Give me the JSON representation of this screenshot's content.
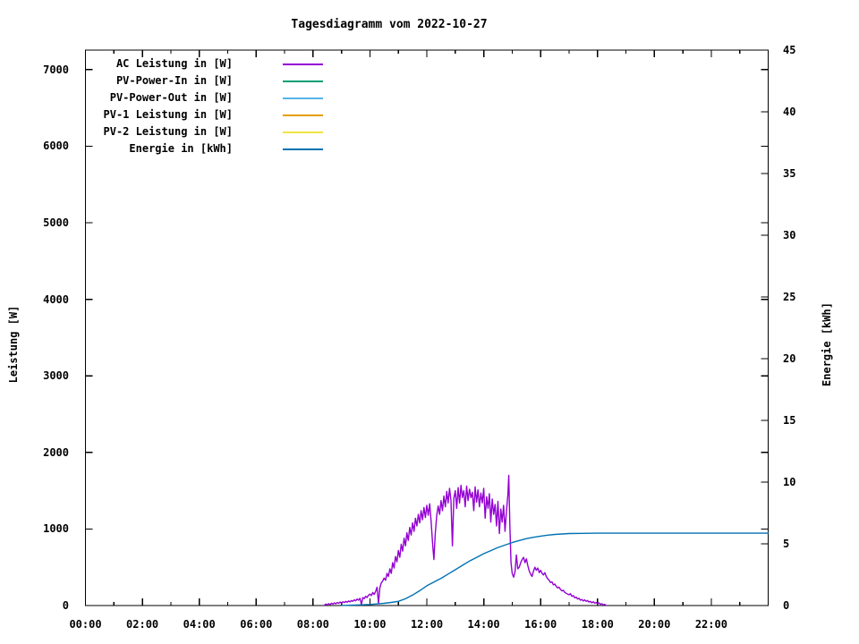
{
  "chart_data": {
    "type": "line",
    "title": "Tagesdiagramm vom 2022-10-27",
    "ylabel": "Leistung [W]",
    "y2label": "Energie [kWh]",
    "x_tick_labels": [
      "00:00",
      "02:00",
      "04:00",
      "06:00",
      "08:00",
      "10:00",
      "12:00",
      "14:00",
      "16:00",
      "18:00",
      "20:00",
      "22:00"
    ],
    "x_range_hours": [
      0,
      24
    ],
    "x_minor_tick_hours": 1,
    "x_major_tick_hours": 2,
    "y1_ticks": [
      0,
      1000,
      2000,
      3000,
      4000,
      5000,
      6000,
      7000
    ],
    "y1_range": [
      0,
      7260
    ],
    "y2_ticks": [
      0,
      5,
      10,
      15,
      20,
      25,
      30,
      35,
      40,
      45
    ],
    "y2_range": [
      0,
      45
    ],
    "grid": false,
    "legend_position": "top-left-inside",
    "series": [
      {
        "name": "AC Leistung in [W]",
        "color": "#9400d3",
        "axis": "y1",
        "visible": true,
        "points": [
          [
            8.4,
            5
          ],
          [
            8.45,
            20
          ],
          [
            8.5,
            8
          ],
          [
            8.55,
            25
          ],
          [
            8.6,
            12
          ],
          [
            8.65,
            30
          ],
          [
            8.7,
            18
          ],
          [
            8.75,
            35
          ],
          [
            8.8,
            22
          ],
          [
            8.85,
            40
          ],
          [
            8.9,
            28
          ],
          [
            8.95,
            45
          ],
          [
            9.0,
            32
          ],
          [
            9.05,
            50
          ],
          [
            9.1,
            38
          ],
          [
            9.15,
            55
          ],
          [
            9.2,
            42
          ],
          [
            9.25,
            60
          ],
          [
            9.3,
            48
          ],
          [
            9.35,
            65
          ],
          [
            9.4,
            55
          ],
          [
            9.45,
            75
          ],
          [
            9.5,
            62
          ],
          [
            9.55,
            85
          ],
          [
            9.6,
            70
          ],
          [
            9.65,
            95
          ],
          [
            9.7,
            15
          ],
          [
            9.75,
            105
          ],
          [
            9.8,
            90
          ],
          [
            9.85,
            120
          ],
          [
            9.9,
            105
          ],
          [
            9.95,
            135
          ],
          [
            10.0,
            150
          ],
          [
            10.05,
            130
          ],
          [
            10.1,
            170
          ],
          [
            10.15,
            145
          ],
          [
            10.2,
            185
          ],
          [
            10.25,
            240
          ],
          [
            10.3,
            25
          ],
          [
            10.35,
            230
          ],
          [
            10.4,
            295
          ],
          [
            10.45,
            320
          ],
          [
            10.5,
            360
          ],
          [
            10.55,
            330
          ],
          [
            10.6,
            420
          ],
          [
            10.65,
            380
          ],
          [
            10.7,
            480
          ],
          [
            10.75,
            420
          ],
          [
            10.8,
            560
          ],
          [
            10.85,
            490
          ],
          [
            10.9,
            640
          ],
          [
            10.95,
            570
          ],
          [
            11.0,
            720
          ],
          [
            11.05,
            630
          ],
          [
            11.1,
            800
          ],
          [
            11.15,
            710
          ],
          [
            11.2,
            880
          ],
          [
            11.25,
            780
          ],
          [
            11.3,
            950
          ],
          [
            11.35,
            850
          ],
          [
            11.4,
            1020
          ],
          [
            11.45,
            920
          ],
          [
            11.5,
            1080
          ],
          [
            11.55,
            970
          ],
          [
            11.6,
            1140
          ],
          [
            11.65,
            1040
          ],
          [
            11.7,
            1190
          ],
          [
            11.75,
            1080
          ],
          [
            11.8,
            1240
          ],
          [
            11.85,
            1120
          ],
          [
            11.9,
            1280
          ],
          [
            11.95,
            1150
          ],
          [
            12.0,
            1310
          ],
          [
            12.05,
            1180
          ],
          [
            12.1,
            1330
          ],
          [
            12.15,
            1100
          ],
          [
            12.2,
            820
          ],
          [
            12.25,
            600
          ],
          [
            12.3,
            950
          ],
          [
            12.35,
            1180
          ],
          [
            12.4,
            1300
          ],
          [
            12.45,
            1190
          ],
          [
            12.5,
            1370
          ],
          [
            12.55,
            1240
          ],
          [
            12.6,
            1430
          ],
          [
            12.65,
            1290
          ],
          [
            12.7,
            1490
          ],
          [
            12.75,
            1340
          ],
          [
            12.8,
            1530
          ],
          [
            12.85,
            1370
          ],
          [
            12.9,
            780
          ],
          [
            12.95,
            1400
          ],
          [
            13.0,
            1500
          ],
          [
            13.05,
            1270
          ],
          [
            13.1,
            1540
          ],
          [
            13.15,
            1340
          ],
          [
            13.2,
            1570
          ],
          [
            13.25,
            1410
          ],
          [
            13.3,
            1500
          ],
          [
            13.35,
            1290
          ],
          [
            13.4,
            1560
          ],
          [
            13.45,
            1370
          ],
          [
            13.5,
            1520
          ],
          [
            13.55,
            1410
          ],
          [
            13.6,
            1480
          ],
          [
            13.65,
            1240
          ],
          [
            13.7,
            1550
          ],
          [
            13.75,
            1350
          ],
          [
            13.8,
            1510
          ],
          [
            13.85,
            1290
          ],
          [
            13.9,
            1470
          ],
          [
            13.95,
            1340
          ],
          [
            14.0,
            1530
          ],
          [
            14.05,
            1140
          ],
          [
            14.1,
            1420
          ],
          [
            14.15,
            1270
          ],
          [
            14.2,
            1460
          ],
          [
            14.25,
            1090
          ],
          [
            14.3,
            1390
          ],
          [
            14.35,
            1190
          ],
          [
            14.4,
            1320
          ],
          [
            14.45,
            1040
          ],
          [
            14.5,
            1360
          ],
          [
            14.55,
            940
          ],
          [
            14.6,
            1260
          ],
          [
            14.65,
            1090
          ],
          [
            14.7,
            1310
          ],
          [
            14.75,
            970
          ],
          [
            14.8,
            1230
          ],
          [
            14.85,
            1450
          ],
          [
            14.88,
            1700
          ],
          [
            14.92,
            1050
          ],
          [
            14.96,
            560
          ],
          [
            15.0,
            420
          ],
          [
            15.05,
            370
          ],
          [
            15.1,
            440
          ],
          [
            15.15,
            660
          ],
          [
            15.2,
            480
          ],
          [
            15.25,
            500
          ],
          [
            15.3,
            560
          ],
          [
            15.35,
            600
          ],
          [
            15.4,
            630
          ],
          [
            15.45,
            560
          ],
          [
            15.5,
            610
          ],
          [
            15.55,
            520
          ],
          [
            15.6,
            450
          ],
          [
            15.65,
            410
          ],
          [
            15.7,
            380
          ],
          [
            15.75,
            450
          ],
          [
            15.8,
            500
          ],
          [
            15.85,
            460
          ],
          [
            15.9,
            490
          ],
          [
            15.95,
            430
          ],
          [
            16.0,
            460
          ],
          [
            16.05,
            420
          ],
          [
            16.1,
            400
          ],
          [
            16.15,
            430
          ],
          [
            16.2,
            380
          ],
          [
            16.25,
            350
          ],
          [
            16.3,
            330
          ],
          [
            16.35,
            300
          ],
          [
            16.4,
            310
          ],
          [
            16.45,
            270
          ],
          [
            16.5,
            280
          ],
          [
            16.55,
            250
          ],
          [
            16.6,
            230
          ],
          [
            16.65,
            240
          ],
          [
            16.7,
            210
          ],
          [
            16.75,
            190
          ],
          [
            16.8,
            200
          ],
          [
            16.85,
            170
          ],
          [
            16.9,
            160
          ],
          [
            16.95,
            150
          ],
          [
            17.0,
            140
          ],
          [
            17.05,
            155
          ],
          [
            17.1,
            120
          ],
          [
            17.15,
            130
          ],
          [
            17.2,
            100
          ],
          [
            17.25,
            110
          ],
          [
            17.3,
            85
          ],
          [
            17.35,
            95
          ],
          [
            17.4,
            70
          ],
          [
            17.45,
            80
          ],
          [
            17.5,
            60
          ],
          [
            17.55,
            75
          ],
          [
            17.6,
            55
          ],
          [
            17.65,
            65
          ],
          [
            17.7,
            45
          ],
          [
            17.75,
            55
          ],
          [
            17.8,
            35
          ],
          [
            17.85,
            50
          ],
          [
            17.9,
            30
          ],
          [
            17.95,
            40
          ],
          [
            18.0,
            25
          ],
          [
            18.05,
            35
          ],
          [
            18.1,
            15
          ],
          [
            18.15,
            25
          ],
          [
            18.2,
            8
          ],
          [
            18.25,
            15
          ],
          [
            18.3,
            3
          ]
        ]
      },
      {
        "name": "PV-Power-In in [W]",
        "color": "#009e73",
        "axis": "y1",
        "visible": false,
        "points": []
      },
      {
        "name": "PV-Power-Out in [W]",
        "color": "#56b4e9",
        "axis": "y1",
        "visible": false,
        "points": []
      },
      {
        "name": "PV-1 Leistung in [W]",
        "color": "#e69f00",
        "axis": "y1",
        "visible": false,
        "points": []
      },
      {
        "name": "PV-2 Leistung in [W]",
        "color": "#f0e442",
        "axis": "y1",
        "visible": false,
        "points": []
      },
      {
        "name": "Energie in [kWh]",
        "color": "#0072b2",
        "axis": "y2",
        "visible": true,
        "points": [
          [
            9.0,
            0.01
          ],
          [
            9.5,
            0.04
          ],
          [
            10.0,
            0.09
          ],
          [
            10.25,
            0.13
          ],
          [
            10.5,
            0.18
          ],
          [
            10.75,
            0.25
          ],
          [
            11.0,
            0.34
          ],
          [
            11.25,
            0.55
          ],
          [
            11.5,
            0.85
          ],
          [
            11.75,
            1.2
          ],
          [
            12.0,
            1.6
          ],
          [
            12.25,
            1.9
          ],
          [
            12.5,
            2.2
          ],
          [
            12.75,
            2.55
          ],
          [
            13.0,
            2.9
          ],
          [
            13.25,
            3.25
          ],
          [
            13.5,
            3.6
          ],
          [
            13.75,
            3.9
          ],
          [
            14.0,
            4.2
          ],
          [
            14.25,
            4.45
          ],
          [
            14.5,
            4.7
          ],
          [
            14.75,
            4.9
          ],
          [
            15.0,
            5.1
          ],
          [
            15.25,
            5.27
          ],
          [
            15.5,
            5.42
          ],
          [
            15.75,
            5.53
          ],
          [
            16.0,
            5.62
          ],
          [
            16.25,
            5.7
          ],
          [
            16.5,
            5.76
          ],
          [
            16.75,
            5.8
          ],
          [
            17.0,
            5.83
          ],
          [
            17.5,
            5.85
          ],
          [
            18.0,
            5.86
          ],
          [
            24.0,
            5.86
          ]
        ]
      }
    ]
  }
}
